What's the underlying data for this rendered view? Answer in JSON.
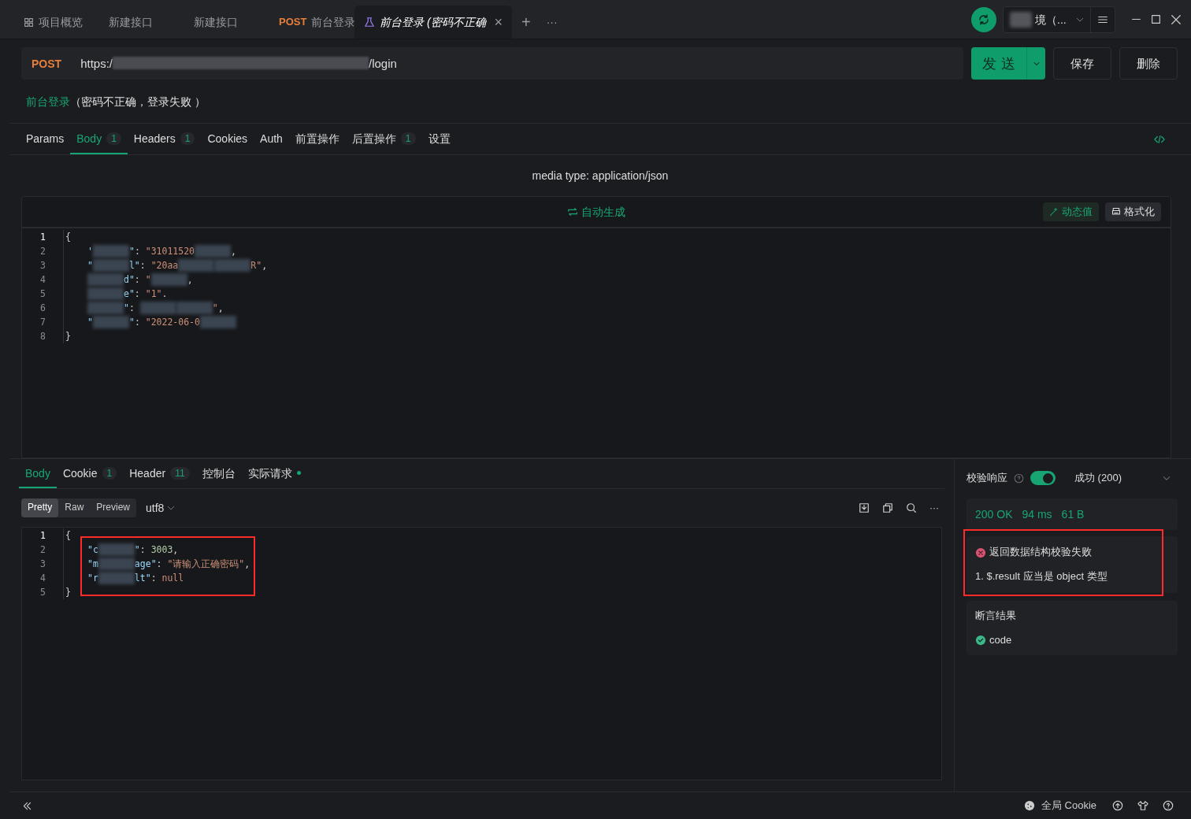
{
  "tabs": [
    {
      "kind": "overview",
      "label": "项目概览",
      "selected": false
    },
    {
      "kind": "plain",
      "label": "新建接口",
      "selected": false
    },
    {
      "kind": "plain",
      "label": "新建接口",
      "selected": false
    },
    {
      "kind": "method",
      "method": "POST",
      "label": "前台登录",
      "selected": false
    },
    {
      "kind": "case",
      "label": "前台登录 (密码不正确",
      "selected": true,
      "close": "×"
    }
  ],
  "add_tab": "+",
  "more_tabs": "···",
  "environment": {
    "label": "境（..."
  },
  "request": {
    "method": "POST",
    "url_start": "https:/",
    "url_end": "/login"
  },
  "buttons": {
    "send": "发 送",
    "save": "保存",
    "delete": "删除"
  },
  "breadcrumb": {
    "link": "前台登录",
    "text": "（密码不正确，登录失败 ）"
  },
  "request_tabs": [
    {
      "label": "Params",
      "selected": false
    },
    {
      "label": "Body",
      "count": "1",
      "selected": true
    },
    {
      "label": "Headers",
      "count": "1",
      "selected": false
    },
    {
      "label": "Cookies",
      "selected": false
    },
    {
      "label": "Auth",
      "selected": false
    },
    {
      "label": "前置操作",
      "selected": false
    },
    {
      "label": "后置操作",
      "count": "1",
      "selected": false
    },
    {
      "label": "设置",
      "selected": false
    }
  ],
  "media_type": "media type: application/json",
  "editor_toolbar": {
    "generate": "自动生成",
    "dynamic": "动态值",
    "format": "格式化"
  },
  "request_body": [
    {
      "number": "1",
      "tokens": [
        {
          "kind": "punct",
          "text": "{"
        }
      ]
    },
    {
      "number": "2",
      "indent": true,
      "tokens": [
        {
          "kind": "key",
          "text": "'"
        },
        {
          "kind": "blur"
        },
        {
          "kind": "key",
          "text": "\""
        },
        {
          "kind": "punct",
          "text": ": "
        },
        {
          "kind": "string",
          "text": "\"31011520"
        },
        {
          "kind": "blur"
        },
        {
          "kind": "punct",
          "text": ","
        }
      ]
    },
    {
      "number": "3",
      "indent": true,
      "tokens": [
        {
          "kind": "key",
          "text": "\""
        },
        {
          "kind": "blur"
        },
        {
          "kind": "key",
          "text": "l\""
        },
        {
          "kind": "punct",
          "text": ": "
        },
        {
          "kind": "string",
          "text": "\"20aa"
        },
        {
          "kind": "blur"
        },
        {
          "kind": "blur"
        },
        {
          "kind": "string",
          "text": "R\""
        },
        {
          "kind": "punct",
          "text": ","
        }
      ]
    },
    {
      "number": "4",
      "indent": true,
      "tokens": [
        {
          "kind": "blur"
        },
        {
          "kind": "key",
          "text": "d\""
        },
        {
          "kind": "punct",
          "text": ": "
        },
        {
          "kind": "string",
          "text": "\""
        },
        {
          "kind": "blur"
        },
        {
          "kind": "punct",
          "text": ","
        }
      ]
    },
    {
      "number": "5",
      "indent": true,
      "tokens": [
        {
          "kind": "blur"
        },
        {
          "kind": "key",
          "text": "e\""
        },
        {
          "kind": "punct",
          "text": ": "
        },
        {
          "kind": "string",
          "text": "\"1\""
        },
        {
          "kind": "punct",
          "text": "."
        }
      ]
    },
    {
      "number": "6",
      "indent": true,
      "tokens": [
        {
          "kind": "blur"
        },
        {
          "kind": "key",
          "text": "\""
        },
        {
          "kind": "punct",
          "text": ": "
        },
        {
          "kind": "blur"
        },
        {
          "kind": "blur"
        },
        {
          "kind": "string",
          "text": "\""
        },
        {
          "kind": "punct",
          "text": ","
        }
      ]
    },
    {
      "number": "7",
      "indent": true,
      "tokens": [
        {
          "kind": "key",
          "text": "\""
        },
        {
          "kind": "blur"
        },
        {
          "kind": "key",
          "text": "\""
        },
        {
          "kind": "punct",
          "text": ": "
        },
        {
          "kind": "string",
          "text": "\"2022-06-0"
        },
        {
          "kind": "blur"
        }
      ]
    },
    {
      "number": "8",
      "tokens": [
        {
          "kind": "punct",
          "text": "}"
        }
      ]
    }
  ],
  "response_tabs": [
    {
      "label": "Body",
      "selected": true
    },
    {
      "label": "Cookie",
      "count": "1",
      "selected": false
    },
    {
      "label": "Header",
      "count": "11",
      "selected": false
    },
    {
      "label": "控制台",
      "selected": false
    },
    {
      "label": "实际请求",
      "dot": true,
      "selected": false
    }
  ],
  "view_modes": [
    {
      "label": "Pretty",
      "selected": true
    },
    {
      "label": "Raw",
      "selected": false
    },
    {
      "label": "Preview",
      "selected": false
    }
  ],
  "encoding": "utf8",
  "response_body": [
    {
      "number": "1",
      "tokens": [
        {
          "kind": "punct",
          "text": "{"
        }
      ]
    },
    {
      "number": "2",
      "indent": true,
      "tokens": [
        {
          "kind": "key",
          "text": "\"c"
        },
        {
          "kind": "blur"
        },
        {
          "kind": "key",
          "text": "\""
        },
        {
          "kind": "punct",
          "text": ": "
        },
        {
          "kind": "number",
          "text": "3003"
        },
        {
          "kind": "punct",
          "text": ","
        }
      ]
    },
    {
      "number": "3",
      "indent": true,
      "tokens": [
        {
          "kind": "key",
          "text": "\"m"
        },
        {
          "kind": "blur"
        },
        {
          "kind": "key",
          "text": "age\""
        },
        {
          "kind": "punct",
          "text": ": "
        },
        {
          "kind": "string",
          "text": "\"请输入正确密码\""
        },
        {
          "kind": "punct",
          "text": ","
        }
      ]
    },
    {
      "number": "4",
      "indent": true,
      "tokens": [
        {
          "kind": "key",
          "text": "\"r"
        },
        {
          "kind": "blur"
        },
        {
          "kind": "key",
          "text": "lt\""
        },
        {
          "kind": "punct",
          "text": ": "
        },
        {
          "kind": "string",
          "text": "null"
        }
      ]
    },
    {
      "number": "5",
      "tokens": [
        {
          "kind": "punct",
          "text": "}"
        }
      ]
    }
  ],
  "validation": {
    "label": "校验响应",
    "on": true,
    "result": "成功 (200)",
    "status": "200 OK",
    "time": "94 ms",
    "size": "61 B",
    "error_title": "返回数据结构校验失败",
    "error_detail": "1. $.result 应当是 object 类型"
  },
  "assertions": {
    "title": "断言结果",
    "items": [
      {
        "label": "code",
        "passed": true
      }
    ]
  },
  "footer": {
    "cookie": "全局 Cookie"
  }
}
